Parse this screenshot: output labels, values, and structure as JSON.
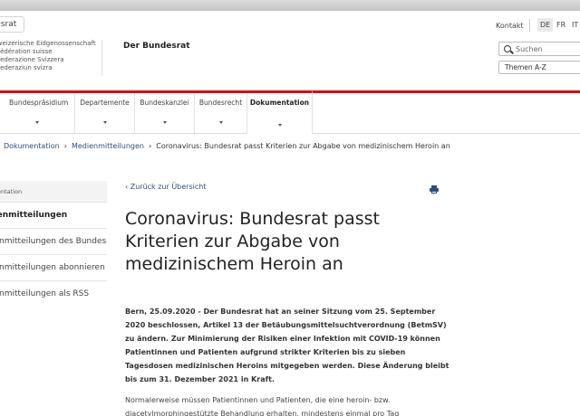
{
  "header": {
    "crumb_tab": "Bundesrat",
    "confederation_lines": [
      "Schweizerische Eidgenossenschaft",
      "Confédération suisse",
      "Confederazione Svizzera",
      "Confederaziun svizra"
    ],
    "department": "Der Bundesrat",
    "contact": "Kontakt",
    "languages": [
      "DE",
      "FR",
      "IT"
    ],
    "active_language": "DE",
    "search_placeholder": "Suchen",
    "themen": "Themen A-Z"
  },
  "nav": {
    "items": [
      {
        "label": "Bundespräsidium"
      },
      {
        "label": "Departemente"
      },
      {
        "label": "Bundeskanzlei"
      },
      {
        "label": "Bundesrecht"
      },
      {
        "label": "Dokumentation"
      }
    ],
    "active": "Dokumentation"
  },
  "breadcrumb": {
    "items": [
      "Dokumentation",
      "Medienmitteilungen",
      "Coronavirus: Bundesrat passt Kriterien zur Abgabe von medizinischem Heroin an"
    ]
  },
  "sidebar": {
    "header": "Dokumentation",
    "items": [
      "Medienmitteilungen",
      "Medienmitteilungen des Bundesrats",
      "Medienmitteilungen abonnieren",
      "Medienmitteilungen als RSS"
    ]
  },
  "article": {
    "back_link": "‹ Zurück zur Übersicht",
    "print_icon": "printer-icon",
    "title": "Coronavirus: Bundesrat passt Kriterien zur Abgabe von medizinischem Heroin an",
    "lead": "Bern, 25.09.2020 - Der Bundesrat hat an seiner Sitzung vom 25. September 2020 beschlossen, Artikel 13 der Betäubungsmittelsuchtverordnung (BetmSV) zu ändern. Zur Minimierung der Risiken einer Infektion mit COVID-19 können Patientinnen und Patienten aufgrund strikter Kriterien bis zu sieben Tagesdosen medizinischen Heroins mitgegeben werden. Diese Änderung bleibt bis zum 31. Dezember 2021 in Kraft.",
    "paragraph": "Normalerweise müssen Patientinnen und Patienten, die eine heroin- bzw. diacetylmorphingestützte Behandlung erhalten, mindestens einmal pro Tag"
  },
  "colors": {
    "accent_red": "#dc0018",
    "link_blue": "#2f4f79"
  }
}
